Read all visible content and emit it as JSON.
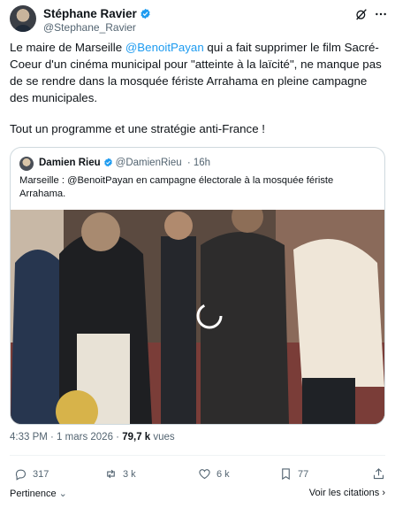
{
  "author": {
    "name": "Stéphane Ravier",
    "handle": "@Stephane_Ravier"
  },
  "icons": {
    "verified": "verified-badge-icon",
    "grok": "grok-icon",
    "more": "more-icon"
  },
  "tweet": {
    "text_parts": [
      "Le maire de Marseille ",
      "@BenoitPayan",
      " qui a fait supprimer le film Sacré-Coeur d'un cinéma municipal pour \"atteinte à la laïcité\", ne manque pas de se rendre dans la mosquée fériste Arrahama en pleine campagne des municipales."
    ],
    "text2": "Tout un programme et une stratégie anti-France !"
  },
  "quote": {
    "name": "Damien Rieu",
    "handle": "@DamienRieu",
    "time": "· 16h",
    "text": "Marseille : @BenoitPayan en campagne électorale à la mosquée fériste Arrahama."
  },
  "meta": {
    "time": "4:33 PM · 1 mars 2026 · ",
    "views_count": "79,7 k",
    "views_label": " vues"
  },
  "actions": {
    "replies": "317",
    "reposts": "3 k",
    "likes": "6 k",
    "bookmarks": "77"
  },
  "footer": {
    "pertinence": "Pertinence",
    "citations": "Voir les citations ›"
  },
  "colors": {
    "accent": "#1d9bf0",
    "muted": "#536471",
    "text": "#0f1419"
  }
}
